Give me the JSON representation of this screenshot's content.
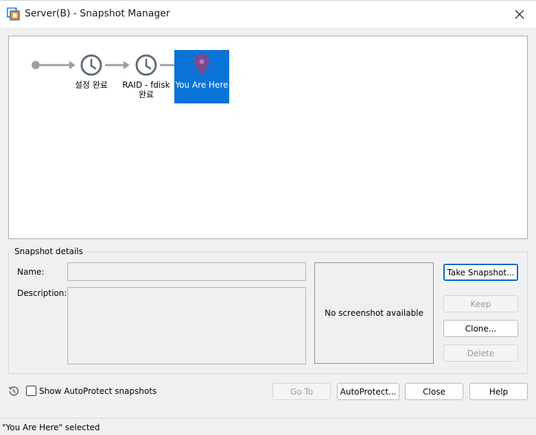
{
  "window": {
    "title": "Server(B) - Snapshot Manager",
    "app_icon": "vmware-workstation-icon",
    "close_icon": "close-icon"
  },
  "tree": {
    "nodes": [
      {
        "label": "설정 완료",
        "icon": "clock-icon"
      },
      {
        "label": "RAID - fdisk\n완료",
        "icon": "clock-icon"
      },
      {
        "label": "You Are Here",
        "icon": "location-pin-icon",
        "selected": true
      }
    ],
    "selection_color": "#0a73d6"
  },
  "details": {
    "legend": "Snapshot details",
    "name_label": "Name:",
    "name_value": "",
    "description_label": "Description:",
    "description_value": "",
    "screenshot_text": "No screenshot available"
  },
  "buttons": {
    "take_snapshot": "Take Snapshot...",
    "keep": "Keep",
    "clone": "Clone...",
    "delete": "Delete",
    "go_to": "Go To",
    "autoprotect": "AutoProtect...",
    "close": "Close",
    "help": "Help"
  },
  "footer": {
    "history_icon": "history-icon",
    "show_autoprotect_label": "Show AutoProtect snapshots",
    "show_autoprotect_checked": false
  },
  "status": {
    "text": "\"You Are Here\" selected"
  }
}
